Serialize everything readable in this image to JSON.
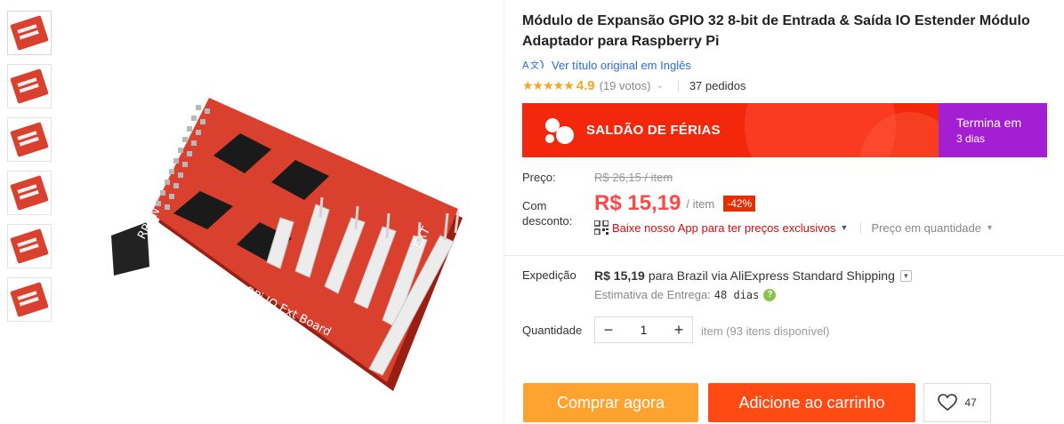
{
  "product": {
    "title": "Módulo de Expansão GPIO 32 8-bit de Entrada & Saída IO Estender Módulo Adaptador para Raspberry Pi",
    "translate_link": "Ver título original em Inglês",
    "rating": {
      "stars": 5,
      "score": "4.9",
      "votes": "(19 votos)",
      "orders": "37 pedidos"
    },
    "board_labels": {
      "board_name": "RPi IO Ext Board",
      "left_header": "RPi IN",
      "right_header": "EXT"
    }
  },
  "thumbnails": [
    {
      "name": "thumb-1"
    },
    {
      "name": "thumb-2"
    },
    {
      "name": "thumb-3"
    },
    {
      "name": "thumb-4"
    },
    {
      "name": "thumb-5"
    },
    {
      "name": "thumb-6"
    }
  ],
  "banner": {
    "title": "SALDÃO DE FÉRIAS",
    "ends_label": "Termina em",
    "ends_value": "3 dias",
    "colors": {
      "main": "#f3270b",
      "ends": "#a41fd4"
    }
  },
  "pricing": {
    "price_label": "Preço:",
    "old_price": "R$ 26,15 / item",
    "discount_label": "Com desconto:",
    "current_price": "R$ 15,19",
    "unit": "/ item",
    "discount_badge": "-42%",
    "app_promo": "Baixe nosso App para ter preços exclusivos",
    "bulk_price": "Preço em quantidade",
    "colors": {
      "price": "#ff4747",
      "badge": "#e62e04"
    }
  },
  "shipping": {
    "label": "Expedição",
    "cost": "R$ 15,19",
    "text": "para Brazil via AliExpress Standard Shipping",
    "eta_label": "Estimativa de Entrega:",
    "eta_value": "48 dias",
    "help_icon": "?"
  },
  "quantity": {
    "label": "Quantidade",
    "value": "1",
    "minus": "−",
    "plus": "+",
    "available": "item (93 itens disponível)"
  },
  "actions": {
    "buy_now": "Comprar agora",
    "add_to_cart": "Adicione ao carrinho",
    "wishlist_count": "47",
    "colors": {
      "buy_now": "#ffa330",
      "add_to_cart": "#ff4b13"
    }
  },
  "icons": {
    "translate": "translate-icon",
    "star": "star-icon",
    "qr": "qr-code-icon",
    "heart": "heart-icon",
    "chevron": "chevron-down-icon"
  }
}
